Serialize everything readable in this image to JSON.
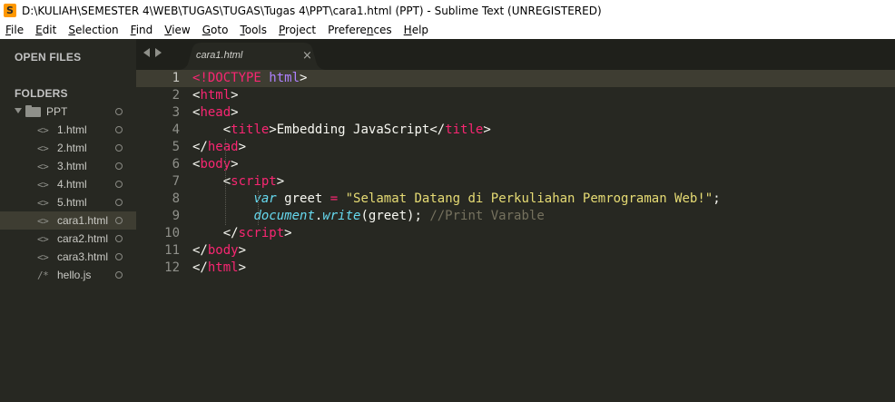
{
  "window": {
    "title": "D:\\KULIAH\\SEMESTER 4\\WEB\\TUGAS\\TUGAS\\Tugas 4\\PPT\\cara1.html (PPT) - Sublime Text (UNREGISTERED)",
    "icon": "sublime-text-icon",
    "icon_letter": "S",
    "accent": "#ff9800"
  },
  "menu": [
    {
      "first": "F",
      "rest": "ile"
    },
    {
      "first": "E",
      "rest": "dit"
    },
    {
      "first": "S",
      "rest": "election"
    },
    {
      "first": "F",
      "rest": "ind"
    },
    {
      "first": "V",
      "rest": "iew"
    },
    {
      "first": "G",
      "rest": "oto"
    },
    {
      "first": "T",
      "rest": "ools"
    },
    {
      "first": "P",
      "rest": "roject"
    },
    {
      "prefix": "Prefere",
      "first": "n",
      "rest": "ces"
    },
    {
      "first": "H",
      "rest": "elp"
    }
  ],
  "sidebar": {
    "open_files_label": "OPEN FILES",
    "folders_label": "FOLDERS",
    "folder": {
      "name": "PPT",
      "icon": "folder-open-icon"
    },
    "files": [
      {
        "name": "1.html",
        "icon": "<>",
        "selected": false
      },
      {
        "name": "2.html",
        "icon": "<>",
        "selected": false
      },
      {
        "name": "3.html",
        "icon": "<>",
        "selected": false
      },
      {
        "name": "4.html",
        "icon": "<>",
        "selected": false
      },
      {
        "name": "5.html",
        "icon": "<>",
        "selected": false
      },
      {
        "name": "cara1.html",
        "icon": "<>",
        "selected": true
      },
      {
        "name": "cara2.html",
        "icon": "<>",
        "selected": false
      },
      {
        "name": "cara3.html",
        "icon": "<>",
        "selected": false
      },
      {
        "name": "hello.js",
        "icon": "/*",
        "selected": false
      }
    ]
  },
  "tabs": [
    {
      "label": "cara1.html",
      "close": "×",
      "active": true
    }
  ],
  "editor": {
    "active_line": 1,
    "lines": [
      {
        "n": "1",
        "tokens": [
          [
            "c-doctype",
            "<!DOCTYPE"
          ],
          [
            "",
            " "
          ],
          [
            "c-doc-html",
            "html"
          ],
          [
            "",
            ">"
          ]
        ]
      },
      {
        "n": "2",
        "tokens": [
          [
            "",
            "<"
          ],
          [
            "c-tag",
            "html"
          ],
          [
            "",
            ">"
          ]
        ]
      },
      {
        "n": "3",
        "tokens": [
          [
            "",
            "<"
          ],
          [
            "c-tag",
            "head"
          ],
          [
            "",
            ">"
          ]
        ]
      },
      {
        "n": "4",
        "tokens": [
          [
            "",
            "    <"
          ],
          [
            "c-tag",
            "title"
          ],
          [
            "",
            ">Embedding JavaScript</"
          ],
          [
            "c-tag",
            "title"
          ],
          [
            "",
            ">"
          ]
        ]
      },
      {
        "n": "5",
        "tokens": [
          [
            "",
            "</"
          ],
          [
            "c-tag",
            "head"
          ],
          [
            "",
            ">"
          ]
        ]
      },
      {
        "n": "6",
        "tokens": [
          [
            "",
            "<"
          ],
          [
            "c-tag",
            "body"
          ],
          [
            "",
            ">"
          ]
        ]
      },
      {
        "n": "7",
        "tokens": [
          [
            "",
            "    <"
          ],
          [
            "c-tag",
            "script"
          ],
          [
            "",
            ">"
          ]
        ]
      },
      {
        "n": "8",
        "tokens": [
          [
            "",
            "        "
          ],
          [
            "c-kw",
            "var"
          ],
          [
            "",
            " greet "
          ],
          [
            "c-op",
            "="
          ],
          [
            "",
            " "
          ],
          [
            "c-str",
            "\"Selamat Datang di Perkuliahan Pemrograman Web!\""
          ],
          [
            "",
            ";"
          ]
        ]
      },
      {
        "n": "9",
        "tokens": [
          [
            "",
            "        "
          ],
          [
            "c-kw",
            "document"
          ],
          [
            "",
            "."
          ],
          [
            "c-kw",
            "write"
          ],
          [
            "",
            "(greet); "
          ],
          [
            "c-cmt",
            "//Print Varable"
          ]
        ]
      },
      {
        "n": "10",
        "tokens": [
          [
            "",
            "    </"
          ],
          [
            "c-tag",
            "script"
          ],
          [
            "",
            ">"
          ]
        ]
      },
      {
        "n": "11",
        "tokens": [
          [
            "",
            "</"
          ],
          [
            "c-tag",
            "body"
          ],
          [
            "",
            ">"
          ]
        ]
      },
      {
        "n": "12",
        "tokens": [
          [
            "",
            "</"
          ],
          [
            "c-tag",
            "html"
          ],
          [
            "",
            ">"
          ]
        ]
      }
    ]
  },
  "colors": {
    "background": "#272822",
    "tag": "#f92672",
    "keyword": "#66d9ef",
    "string": "#e6db74",
    "comment": "#75715e",
    "constant": "#ae81ff"
  }
}
